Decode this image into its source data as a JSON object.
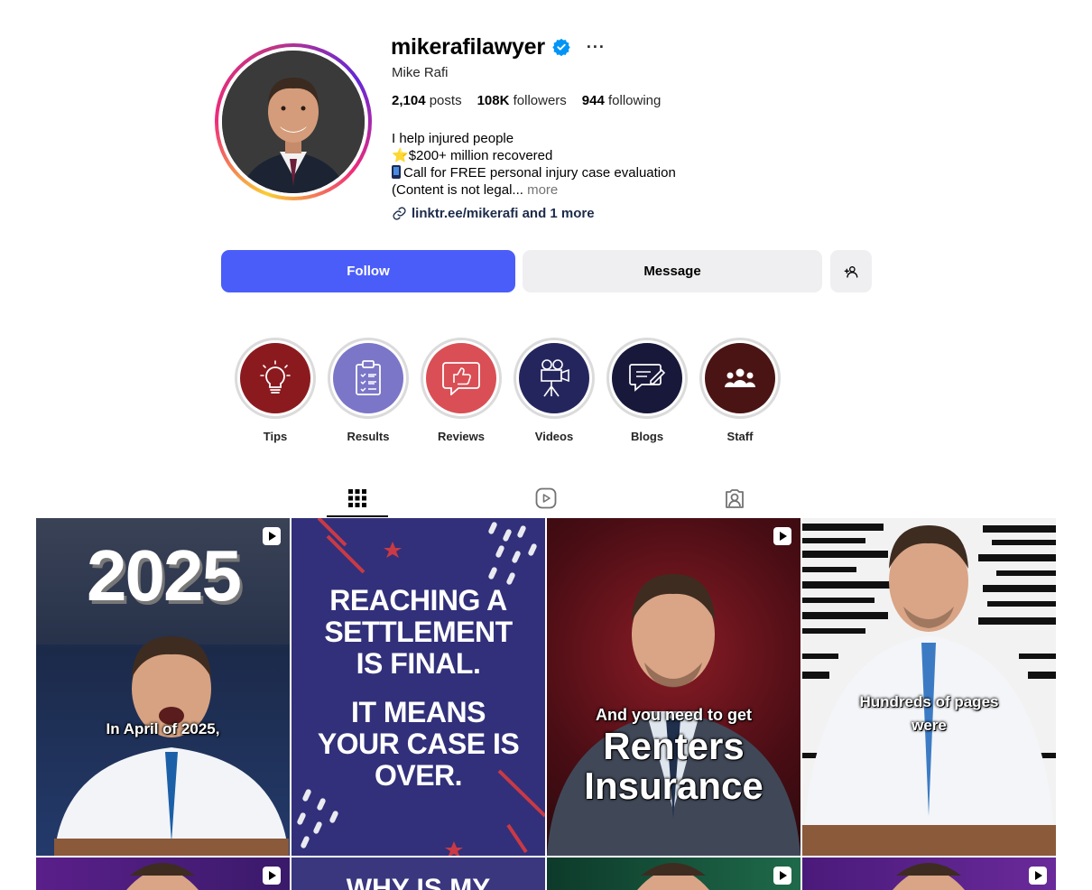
{
  "profile": {
    "username": "mikerafilawyer",
    "more_icon": "more-horizontal-icon",
    "full_name": "Mike Rafi",
    "stats": {
      "posts_count": "2,104",
      "posts_label": "posts",
      "followers_count": "108K",
      "followers_label": "followers",
      "following_count": "944",
      "following_label": "following"
    },
    "bio": {
      "line1": "I help injured people",
      "line2": "$200+ million recovered",
      "line3": "Call for FREE personal injury case evaluation",
      "line4": "(Content is not legal...",
      "more_label": "more"
    },
    "link_text": "linktr.ee/mikerafi and 1 more"
  },
  "actions": {
    "follow_label": "Follow",
    "message_label": "Message"
  },
  "highlights": [
    {
      "label": "Tips",
      "color": "#8b1a1f"
    },
    {
      "label": "Results",
      "color": "#7b76c8"
    },
    {
      "label": "Reviews",
      "color": "#d94f55"
    },
    {
      "label": "Videos",
      "color": "#25255e"
    },
    {
      "label": "Blogs",
      "color": "#18183b"
    },
    {
      "label": "Staff",
      "color": "#4a1414"
    }
  ],
  "tabs": [
    "posts-grid-icon",
    "reels-icon",
    "tagged-icon"
  ],
  "posts": [
    {
      "overlay_big": "2025",
      "caption": "In April of 2025,"
    },
    {
      "line1": "REACHING A",
      "line2": "SETTLEMENT",
      "line3": "IS FINAL.",
      "line4": "IT MEANS",
      "line5": "YOUR CASE IS",
      "line6": "OVER."
    },
    {
      "caption_small": "And you need to get",
      "caption_big1": "Renters",
      "caption_big2": "Insurance"
    },
    {
      "caption_line1": "Hundreds of pages",
      "caption_line2": "were"
    },
    {
      "teaser": "WHY IS MY"
    }
  ],
  "colors": {
    "follow_button": "#4a5df9",
    "secondary_button": "#efeff1",
    "link": "#00376b",
    "verified": "#0095f6"
  }
}
